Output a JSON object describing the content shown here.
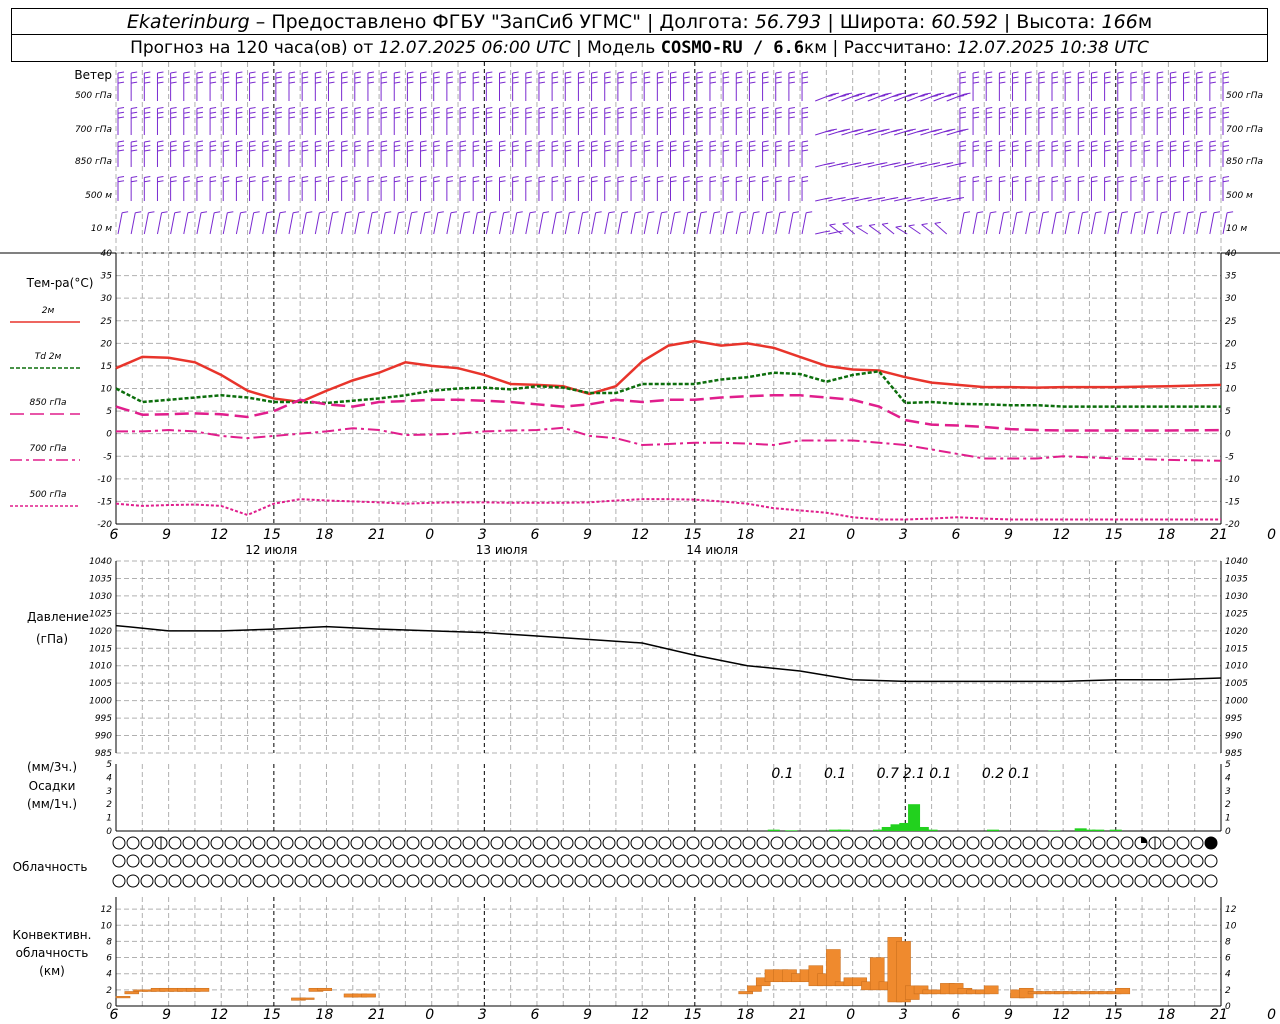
{
  "header": {
    "city": "Ekaterinburg",
    "provider": "– Предоставлено ФГБУ \"ЗапСиб УГМС\"",
    "lon_label": "Долгота:",
    "lon": "56.793",
    "lat_label": "Широта:",
    "lat": "60.592",
    "alt_label": "Высота:",
    "alt": "166",
    "alt_unit": "м",
    "forecast_prefix": "Прогноз на 120 часа(ов) от",
    "forecast_start": "12.07.2025 06:00 UTC",
    "model_label": "Модель",
    "model": "COSMO-RU / 6.6",
    "model_unit": "км",
    "computed_label": "Рассчитано:",
    "computed": "12.07.2025 10:38 UTC"
  },
  "labels": {
    "wind_title": "Ветер",
    "wind_levels": [
      "500 гПа",
      "700 гПа",
      "850 гПа",
      "500 м",
      "10  м"
    ],
    "temp_title": "Тем-ра(°С)",
    "temp_legend": [
      "2м",
      "Td  2м",
      "850 гПа",
      "700 гПа",
      "500 гПа"
    ],
    "pressure_title": "Давление",
    "pressure_unit": "(гПа)",
    "precip_unit3": "(мм/3ч.)",
    "precip_title": "Осадки",
    "precip_unit1": "(мм/1ч.)",
    "cloud_title": "Облачность",
    "conv_title": [
      "Конвективн.",
      "облачность",
      "(км)"
    ],
    "hour_ticks": [
      "6",
      "9",
      "12",
      "15",
      "18",
      "21",
      "0",
      "3",
      "6",
      "9",
      "12",
      "15",
      "18",
      "21",
      "0",
      "3",
      "6",
      "9",
      "12",
      "15",
      "18",
      "21",
      "0",
      "3",
      "6",
      "9",
      "12"
    ],
    "day_labels": [
      "12 июля",
      "13 июля",
      "14 июля"
    ]
  },
  "colors": {
    "wind": "#7a2ad0",
    "t2m": "#e8342b",
    "td2m": "#0c6e0c",
    "t850": "#e01e8c",
    "t700": "#e01e8c",
    "t500": "#e01e8c",
    "pressure": "#000000",
    "precip": "#22d11e",
    "conv": "#ef8a2e"
  },
  "chart_data": [
    {
      "type": "line",
      "name": "temperature",
      "x_hours_from_start": [
        0,
        3,
        6,
        9,
        12,
        15,
        18,
        21,
        24,
        27,
        30,
        33,
        36,
        39,
        42,
        45,
        48,
        51,
        54,
        57,
        60,
        63,
        66,
        69,
        72,
        75,
        78,
        81,
        84,
        87,
        90,
        93,
        96,
        99,
        102,
        105,
        108,
        114,
        120,
        126
      ],
      "ylim": [
        -20,
        40
      ],
      "series": [
        {
          "name": "2м",
          "values": [
            14.5,
            17,
            16.8,
            15.8,
            13,
            9.5,
            7.8,
            7,
            9.5,
            11.8,
            13.5,
            15.8,
            15,
            14.5,
            13,
            11,
            10.8,
            10.5,
            8.8,
            10.5,
            16,
            19.5,
            20.5,
            19.5,
            20,
            19,
            17,
            15,
            14.2,
            14,
            12.5,
            11.3,
            10.8,
            10.3,
            10.3,
            10.2,
            10.3,
            10.3,
            10.5,
            10.8
          ]
        },
        {
          "name": "Td 2м",
          "values": [
            10,
            7,
            7.5,
            8,
            8.5,
            8,
            7,
            7,
            6.8,
            7.3,
            7.8,
            8.5,
            9.5,
            10,
            10.2,
            9.8,
            10.5,
            10.2,
            9,
            9,
            11,
            11,
            11,
            12,
            12.5,
            13.5,
            13.2,
            11.5,
            13,
            13.8,
            6.8,
            7,
            6.6,
            6.5,
            6.3,
            6.3,
            6,
            6,
            6,
            6
          ]
        },
        {
          "name": "850 гПа",
          "values": [
            6,
            4.2,
            4.3,
            4.5,
            4.3,
            3.7,
            5,
            7.5,
            6.5,
            6,
            7,
            7.2,
            7.5,
            7.5,
            7.3,
            7,
            6.5,
            6,
            6.5,
            7.5,
            7,
            7.5,
            7.5,
            8,
            8.3,
            8.5,
            8.5,
            8,
            7.5,
            6,
            3,
            2,
            1.8,
            1.5,
            1,
            0.8,
            0.7,
            0.7,
            0.7,
            0.8
          ]
        },
        {
          "name": "700 гПа",
          "values": [
            0.5,
            0.5,
            0.8,
            0.5,
            -0.5,
            -1,
            -0.5,
            0,
            0.5,
            1.2,
            0.8,
            -0.3,
            -0.2,
            0,
            0.5,
            0.7,
            0.8,
            1.3,
            -0.5,
            -1,
            -2.5,
            -2.3,
            -2,
            -2,
            -2.2,
            -2.5,
            -1.5,
            -1.5,
            -1.5,
            -2,
            -2.5,
            -3.5,
            -4.5,
            -5.5,
            -5.5,
            -5.5,
            -5,
            -5.5,
            -5.8,
            -6
          ]
        },
        {
          "name": "500 гПа",
          "values": [
            -15.5,
            -16,
            -15.8,
            -15.7,
            -16,
            -18,
            -15.5,
            -14.5,
            -14.8,
            -15,
            -15.2,
            -15.5,
            -15.3,
            -15.2,
            -15.2,
            -15.3,
            -15.3,
            -15.3,
            -15.2,
            -14.8,
            -14.5,
            -14.5,
            -14.6,
            -15,
            -15.5,
            -16.5,
            -17,
            -17.5,
            -18.5,
            -19,
            -19,
            -18.8,
            -18.5,
            -18.8,
            -19,
            -19,
            -19,
            -19,
            -19,
            -19
          ]
        }
      ]
    },
    {
      "type": "line",
      "name": "pressure",
      "ylabel": "(гПа)",
      "ylim": [
        985,
        1040
      ],
      "x_hours_from_start": [
        0,
        6,
        12,
        18,
        24,
        30,
        36,
        42,
        48,
        54,
        60,
        66,
        72,
        78,
        84,
        90,
        96,
        102,
        108,
        114,
        120,
        126
      ],
      "values": [
        1021.5,
        1020,
        1020,
        1020.5,
        1021.2,
        1020.5,
        1020,
        1019.5,
        1018.5,
        1017.5,
        1016.5,
        1013,
        1010,
        1008.5,
        1006,
        1005.5,
        1005.5,
        1005.5,
        1005.5,
        1006,
        1006,
        1006.5
      ]
    },
    {
      "type": "bar",
      "name": "precipitation",
      "ylim": [
        0,
        5
      ],
      "x_hours_from_start": [
        75,
        77,
        82,
        83,
        87,
        88,
        89,
        90,
        91,
        92,
        93,
        100,
        107,
        110,
        111,
        112,
        114
      ],
      "values": [
        0.1,
        0.05,
        0.1,
        0.1,
        0.1,
        0.3,
        0.5,
        0.6,
        2.0,
        0.3,
        0.1,
        0.1,
        0.05,
        0.2,
        0.1,
        0.1,
        0.1
      ],
      "labels_3h": [
        {
          "x_hours_from_start": 76,
          "text": "0.1"
        },
        {
          "x_hours_from_start": 82,
          "text": "0.1"
        },
        {
          "x_hours_from_start": 88,
          "text": "0.7"
        },
        {
          "x_hours_from_start": 91,
          "text": "2.1"
        },
        {
          "x_hours_from_start": 94,
          "text": "0.1"
        },
        {
          "x_hours_from_start": 100,
          "text": "0.2"
        },
        {
          "x_hours_from_start": 103,
          "text": "0.1"
        }
      ]
    },
    {
      "type": "bar",
      "name": "convective_cloud",
      "ylim": [
        0,
        13
      ],
      "x_hours_from_start": [
        0,
        1,
        2,
        3,
        4,
        5,
        6,
        7,
        8,
        9,
        20,
        21,
        22,
        23,
        26,
        27,
        28,
        71,
        72,
        73,
        74,
        75,
        76,
        77,
        78,
        79,
        80,
        81,
        82,
        83,
        84,
        85,
        86,
        87,
        88,
        89,
        90,
        91,
        92,
        93,
        94,
        95,
        96,
        97,
        98,
        99,
        102,
        103,
        104,
        105,
        106,
        107,
        108,
        109,
        110,
        111,
        112,
        113,
        114
      ],
      "bottom_km": [
        1,
        1.5,
        1.8,
        1.8,
        1.8,
        1.8,
        1.8,
        1.8,
        1.8,
        1.8,
        0.7,
        0.8,
        1.8,
        1.9,
        1.1,
        1.1,
        1.1,
        1.5,
        1.8,
        2.5,
        3,
        3,
        3,
        3,
        3,
        2.5,
        2.5,
        2.5,
        2.5,
        2.5,
        2.5,
        2,
        2,
        2,
        0.5,
        0.5,
        0.8,
        1.5,
        1.5,
        1.5,
        1.5,
        1.5,
        1.5,
        1.5,
        1.5,
        1.5,
        1.0,
        1.0,
        1.5,
        1.5,
        1.5,
        1.5,
        1.5,
        1.5,
        1.5,
        1.5,
        1.5,
        1.5,
        1.5
      ],
      "top_km": [
        1.2,
        1.8,
        2,
        2,
        2.2,
        2.2,
        2.2,
        2.2,
        2.2,
        2.2,
        1,
        1,
        2.2,
        2.2,
        1.5,
        1.5,
        1.5,
        1.8,
        2.5,
        3.5,
        4.5,
        4.5,
        4.5,
        4,
        4.5,
        5,
        4,
        7,
        3,
        3.5,
        3.5,
        3,
        6,
        3,
        8.5,
        8,
        2.5,
        2.5,
        2,
        2,
        2.8,
        2.8,
        2.2,
        2,
        2,
        2.5,
        2,
        2.2,
        1.8,
        1.8,
        1.8,
        1.8,
        1.8,
        1.8,
        1.8,
        1.8,
        1.8,
        1.8,
        2.2
      ]
    },
    {
      "type": "table",
      "name": "cloud_cover",
      "rows": [
        "0001000000000000000000000000000000000000000000000000000000000000000000000310004444100200330000000000000000000000000000000000",
        "0000000000000000000000000000000000000000000000000000000000000000000000000000000000000000000000000000000000000000000000000000",
        "0000000000000000000000000000000000000000000000000000000000000000000000000000000000000000000000000000000000000000000000000000"
      ]
    }
  ]
}
